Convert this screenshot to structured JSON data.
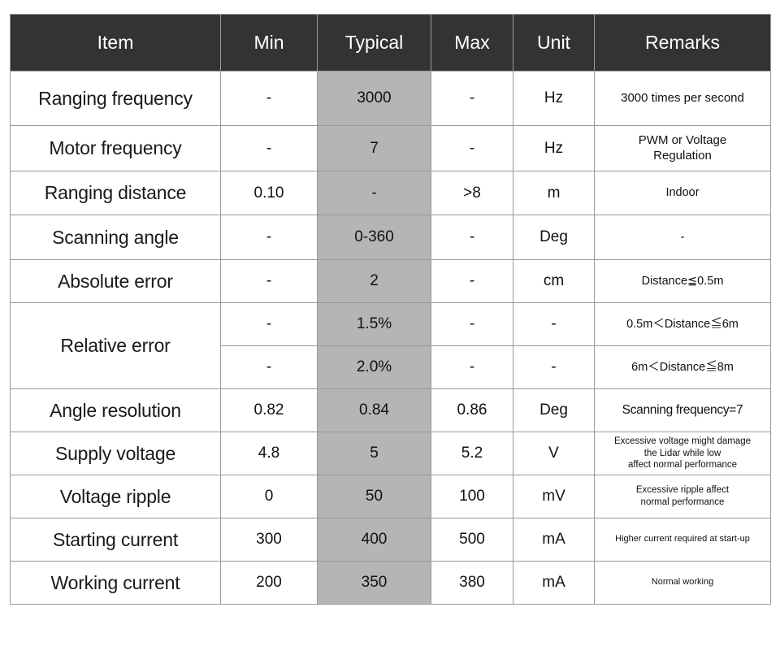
{
  "table": {
    "columns": [
      {
        "key": "item",
        "label": "Item"
      },
      {
        "key": "min",
        "label": "Min"
      },
      {
        "key": "typical",
        "label": "Typical"
      },
      {
        "key": "max",
        "label": "Max"
      },
      {
        "key": "unit",
        "label": "Unit"
      },
      {
        "key": "remarks",
        "label": "Remarks"
      }
    ],
    "header_bg": "#333333",
    "header_color": "#ffffff",
    "typical_column_bg": "#b5b5b5",
    "border_color": "#9a9a9a",
    "rows": [
      {
        "item": "Ranging frequency",
        "min": "-",
        "typical": "3000",
        "max": "-",
        "unit": "Hz",
        "remarks": "3000 times per second"
      },
      {
        "item": "Motor frequency",
        "min": "-",
        "typical": "7",
        "max": "-",
        "unit": "Hz",
        "remarks_line1": "PWM or Voltage",
        "remarks_line2": "Regulation"
      },
      {
        "item": "Ranging distance",
        "min": "0.10",
        "typical": "-",
        "max": ">8",
        "unit": "m",
        "remarks": "Indoor"
      },
      {
        "item": "Scanning angle",
        "min": "-",
        "typical": "0-360",
        "max": "-",
        "unit": "Deg",
        "remarks": "-"
      },
      {
        "item": "Absolute error",
        "min": "-",
        "typical": "2",
        "max": "-",
        "unit": "cm",
        "remarks": "Distance≦0.5m"
      },
      {
        "item": "Relative error",
        "min": "-",
        "typical": "1.5%",
        "max": "-",
        "unit": "-",
        "remarks": "0.5m＜Distance≦6m"
      },
      {
        "item": "",
        "min": "-",
        "typical": "2.0%",
        "max": "-",
        "unit": "-",
        "remarks": "6m＜Distance≦8m"
      },
      {
        "item": "Angle resolution",
        "min": "0.82",
        "typical": "0.84",
        "max": "0.86",
        "unit": "Deg",
        "remarks": "Scanning frequency=7"
      },
      {
        "item": "Supply voltage",
        "min": "4.8",
        "typical": "5",
        "max": "5.2",
        "unit": "V",
        "remarks_line1": "Excessive voltage might damage",
        "remarks_line2": "the Lidar while low",
        "remarks_line3": "affect normal performance"
      },
      {
        "item": "Voltage ripple",
        "min": "0",
        "typical": "50",
        "max": "100",
        "unit": "mV",
        "remarks_line1": "Excessive ripple affect",
        "remarks_line2": "normal performance"
      },
      {
        "item": "Starting current",
        "min": "300",
        "typical": "400",
        "max": "500",
        "unit": "mA",
        "remarks": "Higher current required at start-up"
      },
      {
        "item": "Working current",
        "min": "200",
        "typical": "350",
        "max": "380",
        "unit": "mA",
        "remarks": "Normal working"
      }
    ]
  }
}
